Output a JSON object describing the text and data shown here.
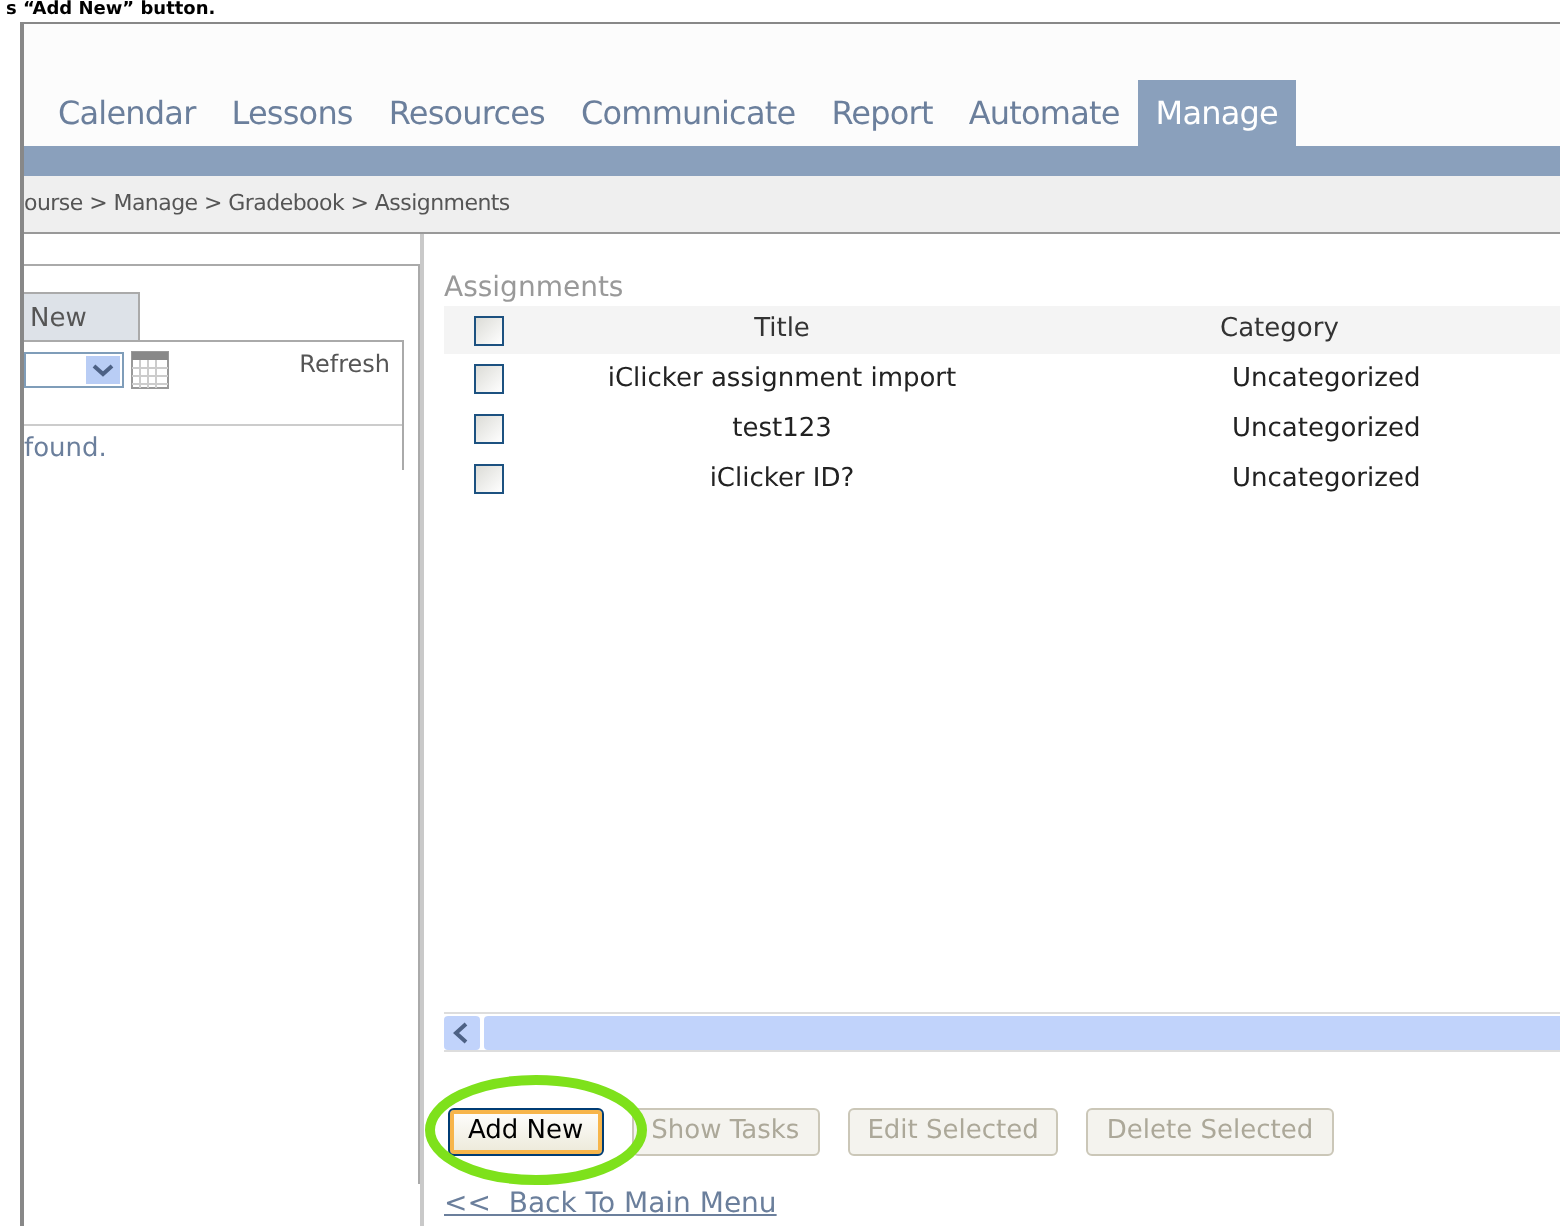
{
  "caption": "s “Add New” button.",
  "tabs": [
    {
      "label": "Calendar",
      "selected": false
    },
    {
      "label": "Lessons",
      "selected": false
    },
    {
      "label": "Resources",
      "selected": false
    },
    {
      "label": "Communicate",
      "selected": false
    },
    {
      "label": "Report",
      "selected": false
    },
    {
      "label": "Automate",
      "selected": false
    },
    {
      "label": "Manage",
      "selected": true
    }
  ],
  "breadcrumb": "ourse > Manage > Gradebook > Assignments",
  "left_panel": {
    "tab": "New",
    "refresh": "Refresh",
    "message": "found."
  },
  "assignments": {
    "title": "Assignments",
    "header_checked": false,
    "columns": [
      "Title",
      "Category"
    ],
    "rows": [
      {
        "title": "iClicker assignment import",
        "category": "Uncategorized",
        "checked": false
      },
      {
        "title": "test123",
        "category": "Uncategorized",
        "checked": false
      },
      {
        "title": "iClicker ID?",
        "category": "Uncategorized",
        "checked": false
      }
    ]
  },
  "buttons": [
    {
      "label": "Add New",
      "disabled": false,
      "highlighted": true
    },
    {
      "label": "Show Tasks",
      "disabled": true,
      "highlighted": false
    },
    {
      "label": "Edit Selected",
      "disabled": true,
      "highlighted": false
    },
    {
      "label": "Delete Selected",
      "disabled": true,
      "highlighted": false
    }
  ],
  "back_link": "<<  Back To Main Menu"
}
